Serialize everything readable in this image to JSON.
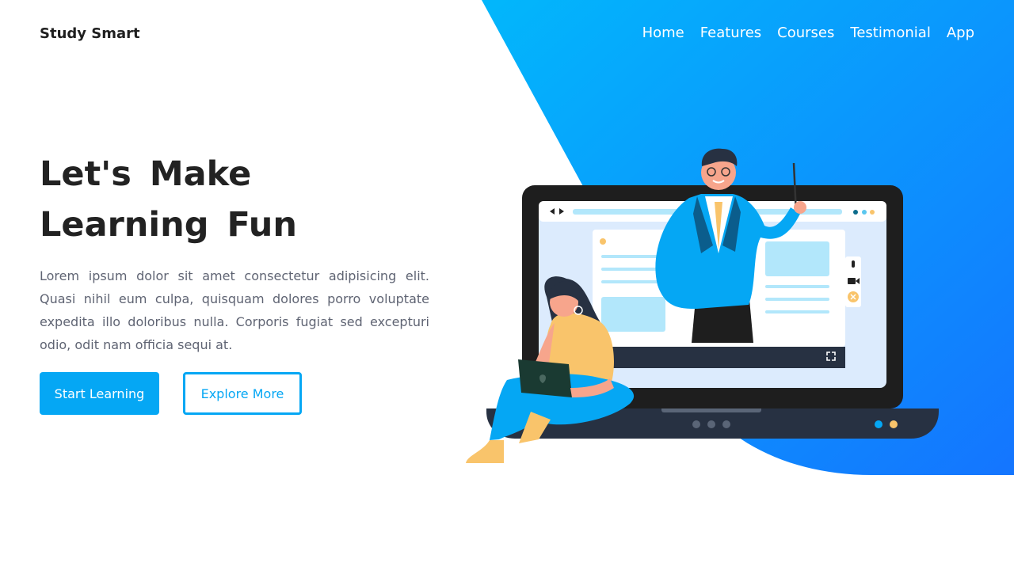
{
  "brand": {
    "name": "Study Smart"
  },
  "nav": {
    "items": [
      "Home",
      "Features",
      "Courses",
      "Testimonial",
      "App"
    ]
  },
  "hero": {
    "title": "Let's Make Learning Fun",
    "description": "Lorem ipsum dolor sit amet consectetur adipisicing elit. Quasi nihil eum culpa, quisquam dolores porro voluptate expedita illo doloribus nulla. Corporis fugiat sed excepturi odio, odit nam officia sequi at.",
    "primary_button": "Start Learning",
    "secondary_button": "Explore More"
  },
  "colors": {
    "accent": "#05a7f4",
    "gradient_start": "#02b7fb",
    "gradient_end": "#1475ff",
    "dark_text": "#222222"
  }
}
